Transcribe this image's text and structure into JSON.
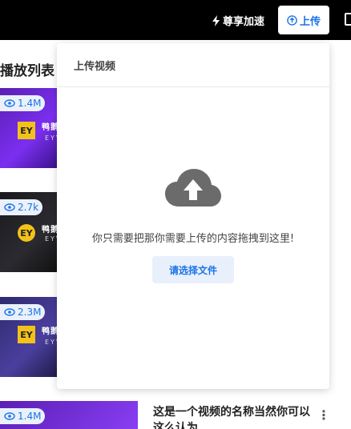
{
  "topbar": {
    "vip_label": "尊享加速",
    "upload_label": "上传"
  },
  "playlist": {
    "title": "播放列表",
    "items": [
      {
        "views": "1.4M",
        "badge": "EY",
        "brand": "鸭鹅",
        "brand_sub": "EYV"
      },
      {
        "views": "2.7k",
        "badge": "EY",
        "brand": "鸭鹅",
        "brand_sub": "EYV"
      },
      {
        "views": "2.3M",
        "badge": "EY",
        "brand": "鸭鹅",
        "brand_sub": "EYV"
      },
      {
        "views": "1.4M"
      }
    ],
    "last_row_title": "这是一个视频的名称当然你可以这么认为"
  },
  "upload_panel": {
    "title": "上传视频",
    "drop_text": "你只需要把那你需要上传的内容拖拽到这里!",
    "choose_button": "请选择文件"
  },
  "colors": {
    "accent": "#1a73e8",
    "topbar_bg": "#000000",
    "cloud": "#6b6b6b"
  }
}
